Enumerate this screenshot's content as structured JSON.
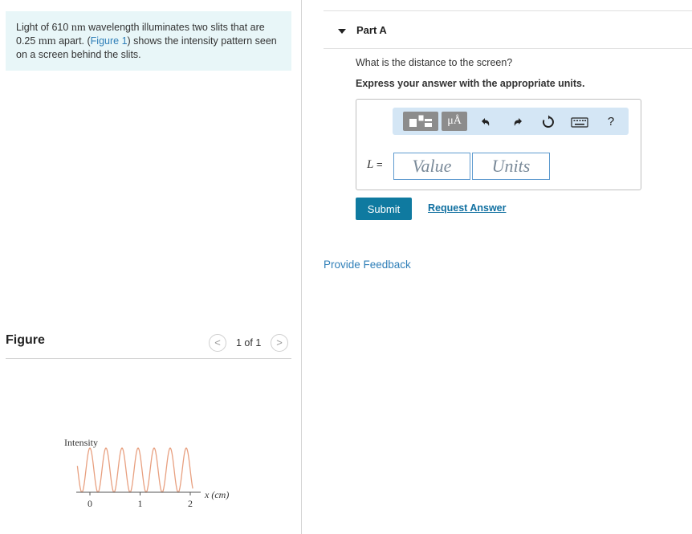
{
  "problem": {
    "text_1": "Light of 610 ",
    "unit_nm": "nm",
    "text_2": " wavelength illuminates two slits that are 0.25 ",
    "unit_mm": "mm",
    "text_3": " apart. (",
    "figure_link": "Figure 1",
    "text_4": ") shows the intensity pattern seen on a screen behind the slits."
  },
  "figure": {
    "title": "Figure",
    "counter": "1 of 1",
    "prev_icon": "chevron-left-icon",
    "next_icon": "chevron-right-icon",
    "prev_glyph": "<",
    "next_glyph": ">",
    "chart_data": {
      "type": "line",
      "title": "",
      "ylabel": "Intensity",
      "xlabel": "x (cm)",
      "x_ticks": [
        "0",
        "1",
        "2"
      ],
      "xlim": [
        -0.25,
        2.05
      ],
      "fringe_spacing_cm": 0.32,
      "curve": "cos^2 interference pattern",
      "color": "#e8a080"
    }
  },
  "part": {
    "caret_icon": "caret-down-icon",
    "title": "Part A",
    "question": "What is the distance to the screen?",
    "instruction": "Express your answer with the appropriate units."
  },
  "toolbar": {
    "template_icon": "template-icon",
    "units_label": "μÅ",
    "undo_icon": "undo-icon",
    "redo_icon": "redo-icon",
    "reset_icon": "reset-icon",
    "keyboard_icon": "keyboard-icon",
    "help_label": "?"
  },
  "answer": {
    "variable": "L",
    "equals": " =",
    "value_placeholder": "Value",
    "units_placeholder": "Units"
  },
  "actions": {
    "submit_label": "Submit",
    "request_answer_label": "Request Answer",
    "feedback_label": "Provide Feedback"
  },
  "colors": {
    "accent": "#0f7aa0",
    "link": "#2f7fb8",
    "problem_bg": "#e8f6f8",
    "toolbar_bg": "#d4e6f5"
  }
}
